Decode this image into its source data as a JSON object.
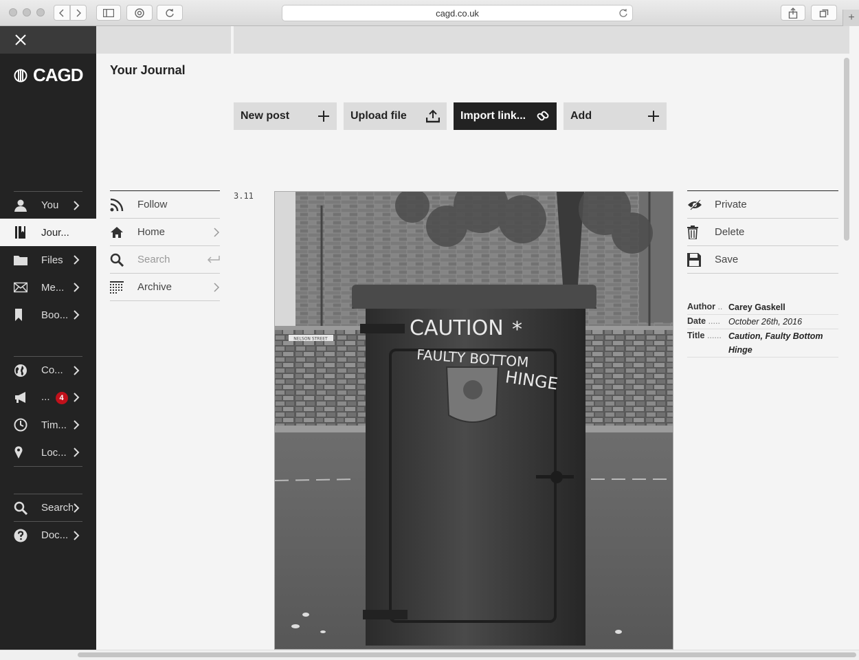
{
  "browser": {
    "url": "cagd.co.uk"
  },
  "sidebar": {
    "logo_text": "CAGD",
    "items": [
      {
        "label": "You",
        "icon": "user-icon"
      },
      {
        "label": "Jour...",
        "icon": "journal-icon",
        "active": true
      },
      {
        "label": "Files",
        "icon": "folder-icon"
      },
      {
        "label": "Me...",
        "icon": "envelope-icon"
      },
      {
        "label": "Boo...",
        "icon": "bookmark-icon"
      },
      {
        "label": "Co...",
        "icon": "globe-icon"
      },
      {
        "label": "...",
        "icon": "megaphone-icon",
        "badge": "4"
      },
      {
        "label": "Tim...",
        "icon": "clock-icon"
      },
      {
        "label": "Loc...",
        "icon": "location-pin-icon"
      },
      {
        "label": "Search",
        "icon": "search-icon"
      },
      {
        "label": "Doc...",
        "icon": "help-icon"
      }
    ]
  },
  "main": {
    "title": "Your Journal",
    "actions": [
      {
        "label": "New post",
        "icon": "plus-icon"
      },
      {
        "label": "Upload file",
        "icon": "upload-icon"
      },
      {
        "label": "Import link...",
        "icon": "link-icon"
      },
      {
        "label": "Add",
        "icon": "plus-icon"
      }
    ],
    "subnav": [
      {
        "label": "Follow",
        "icon": "rss-icon"
      },
      {
        "label": "Home",
        "icon": "home-icon"
      },
      {
        "label": "Search",
        "icon": "search-icon"
      },
      {
        "label": "Archive",
        "icon": "archive-icon"
      }
    ],
    "post_number": "3.11",
    "photo": {
      "sign_text": "NELSON STREET",
      "graffiti": [
        "CAUTION",
        "FAULTY BOTTOM",
        "HINGE"
      ]
    }
  },
  "post_actions": [
    {
      "label": "Private",
      "icon": "eye-slash-icon"
    },
    {
      "label": "Delete",
      "icon": "trash-icon"
    },
    {
      "label": "Save",
      "icon": "save-icon"
    }
  ],
  "meta": {
    "author_key": "Author",
    "author_dots": "..",
    "author": "Carey Gaskell",
    "date_key": "Date",
    "date_dots": ".....",
    "date": "October 26th, 2016",
    "title_key": "Title",
    "title_dots": "......",
    "title": "Caution, Faulty Bottom Hinge"
  },
  "colors": {
    "sidebar_bg": "#232323",
    "accent_dark": "#222222",
    "badge": "#c0111b",
    "page_bg": "#f4f4f4"
  }
}
